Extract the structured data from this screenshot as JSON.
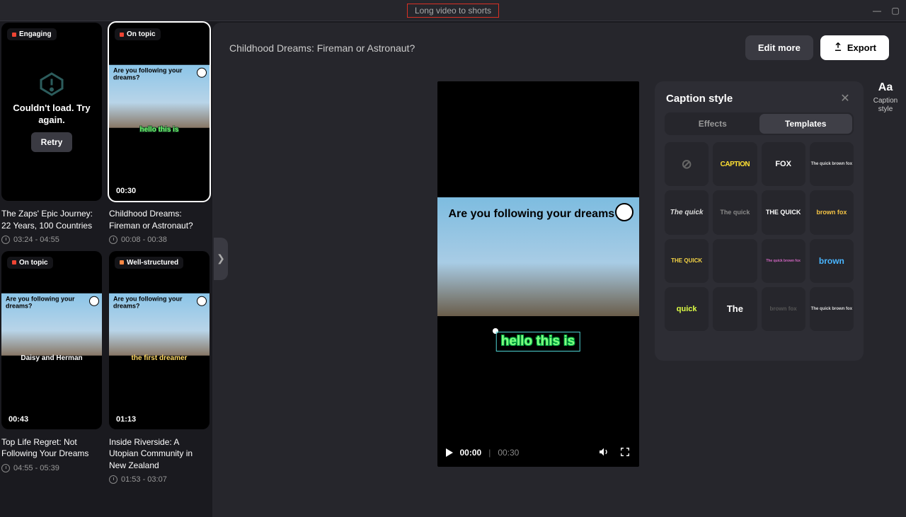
{
  "titlebar": {
    "title": "Long video to shorts"
  },
  "sidebar": {
    "clips": [
      {
        "badge": "Engaging",
        "error": true,
        "error_text": "Couldn't load. Try again.",
        "retry_label": "Retry",
        "title": "The Zaps' Epic Journey: 22 Years, 100 Countries",
        "timerange": "03:24 - 04:55"
      },
      {
        "badge": "On topic",
        "video_text": "Are you following your dreams?",
        "caption": "hello this is",
        "caption_style": "green",
        "duration": "00:30",
        "title": "Childhood Dreams: Fireman or Astronaut?",
        "timerange": "00:08 - 00:38",
        "selected": true
      },
      {
        "badge": "On topic",
        "video_text": "Are you following your dreams?",
        "caption": "Daisy and Herman",
        "caption_style": "white",
        "duration": "00:43",
        "title": "Top Life Regret: Not Following Your Dreams",
        "timerange": "04:55 - 05:39"
      },
      {
        "badge": "Well-structured",
        "video_text": "Are you following your dreams?",
        "caption": "the first dreamer",
        "caption_style": "yellow",
        "duration": "01:13",
        "title": "Inside Riverside: A Utopian Community in New Zealand",
        "timerange": "01:53 - 03:07"
      }
    ]
  },
  "content": {
    "title": "Childhood Dreams: Fireman or Astronaut?",
    "edit_more": "Edit more",
    "export": "Export",
    "player": {
      "video_text": "Are you following your dreams?",
      "caption": "hello this is",
      "current": "00:00",
      "total": "00:30"
    }
  },
  "caption_panel": {
    "title": "Caption style",
    "tabs": {
      "effects": "Effects",
      "templates": "Templates"
    },
    "active_tab": "Templates",
    "templates": [
      {
        "id": "none",
        "label": "⊘",
        "cls": "tc-none"
      },
      {
        "id": "caption",
        "label": "CAPTION",
        "cls": "tc-caption"
      },
      {
        "id": "fox",
        "label": "FOX",
        "cls": "tc-fox"
      },
      {
        "id": "qbf1",
        "label": "The quick brown fox",
        "cls": "tc-qbf1"
      },
      {
        "id": "quick-italic",
        "label": "The quick",
        "cls": "tc-quick-italic"
      },
      {
        "id": "quick-gray",
        "label": "The quick",
        "cls": "tc-quick-gray"
      },
      {
        "id": "quick-white",
        "label": "THE QUICK",
        "cls": "tc-quick-white"
      },
      {
        "id": "brownfox",
        "label": "brown fox",
        "cls": "tc-brownfox"
      },
      {
        "id": "quick-yellow",
        "label": "THE QUICK",
        "cls": "tc-quick-yellow"
      },
      {
        "id": "empty1",
        "label": "",
        "cls": ""
      },
      {
        "id": "qbf2",
        "label": "The quick brown fox",
        "cls": "tc-qbf2"
      },
      {
        "id": "brown",
        "label": "brown",
        "cls": "tc-brown"
      },
      {
        "id": "quick-lime",
        "label": "quick",
        "cls": "tc-quick-lime"
      },
      {
        "id": "the",
        "label": "The",
        "cls": "tc-the"
      },
      {
        "id": "dim",
        "label": "brown fox",
        "cls": "tc-dim"
      },
      {
        "id": "qbf3",
        "label": "The quick brown fox",
        "cls": "tc-qbf3"
      }
    ]
  },
  "right_rail": {
    "label": "Caption style"
  }
}
